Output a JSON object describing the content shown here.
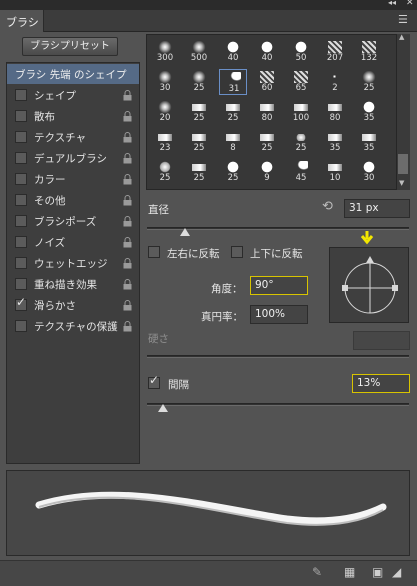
{
  "panel": {
    "tab_title": "ブラシ"
  },
  "left": {
    "preset_button": "ブラシプリセット",
    "section": "ブラシ 先端 のシェイプ",
    "options": [
      {
        "label": "シェイプ",
        "checked": false
      },
      {
        "label": "散布",
        "checked": false
      },
      {
        "label": "テクスチャ",
        "checked": false
      },
      {
        "label": "デュアルブラシ",
        "checked": false
      },
      {
        "label": "カラー",
        "checked": false
      },
      {
        "label": "その他",
        "checked": false
      },
      {
        "label": "ブラシポーズ",
        "checked": false
      },
      {
        "label": "ノイズ",
        "checked": false
      },
      {
        "label": "ウェットエッジ",
        "checked": false
      },
      {
        "label": "重ね描き効果",
        "checked": false
      },
      {
        "label": "滑らかさ",
        "checked": true
      },
      {
        "label": "テクスチャの保護",
        "checked": false
      }
    ]
  },
  "tips": {
    "rows": [
      [
        "300",
        "500",
        "40",
        "40",
        "50",
        "207",
        "132"
      ],
      [
        "30",
        "25",
        "31",
        "60",
        "65",
        "2",
        "25"
      ],
      [
        "20",
        "25",
        "25",
        "80",
        "100",
        "80",
        "35"
      ],
      [
        "23",
        "25",
        "8",
        "25",
        "25",
        "35",
        "35"
      ],
      [
        "25",
        "25",
        "25",
        "9",
        "45",
        "10",
        "30"
      ]
    ],
    "selected_size": "31"
  },
  "settings": {
    "diameter_label": "直径",
    "diameter_value": "31 px",
    "flip_x_label": "左右に反転",
    "flip_y_label": "上下に反転",
    "angle_label": "角度：",
    "angle_value": "90°",
    "roundness_label": "真円率：",
    "roundness_value": "100%",
    "hardness_label": "硬さ",
    "spacing_label": "間隔",
    "spacing_checked": true,
    "spacing_value": "13%"
  },
  "colors": {
    "highlight": "#d8c400",
    "section_bg": "#556a86",
    "arrow": "#f2e600"
  }
}
